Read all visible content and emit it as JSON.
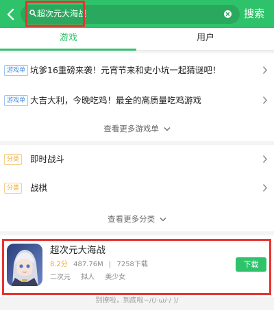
{
  "search": {
    "query": "超次元大海战",
    "button_label": "搜索"
  },
  "tabs": [
    {
      "label": "游戏",
      "active": true
    },
    {
      "label": "用户",
      "active": false
    }
  ],
  "game_lists": {
    "items": [
      {
        "tag": "游戏单",
        "title": "坑爹16重磅来袭！元宵节来和史小坑一起猜谜吧！"
      },
      {
        "tag": "游戏单",
        "title": "大吉大利，今晚吃鸡！最全的高质量吃鸡游戏"
      }
    ],
    "more_label": "查看更多游戏单"
  },
  "categories": {
    "items": [
      {
        "tag": "分类",
        "title": "即时战斗"
      },
      {
        "tag": "分类",
        "title": "战棋"
      }
    ],
    "more_label": "查看更多分类"
  },
  "app": {
    "name": "超次元大海战",
    "score": "8.2分",
    "size": "487.76M",
    "separator": "|",
    "downloads": "7258下载",
    "tags": [
      "二次元",
      "拟人",
      "美少女"
    ],
    "download_label": "下载"
  },
  "footer": "别撩啦，到底啦~/(/·ω/·/ )/",
  "colors": {
    "brand_green": "#2ec36a",
    "highlight_red": "#e8332f",
    "tag_blue": "#4a90e2",
    "tag_orange": "#f5a623"
  },
  "icons": [
    "back-arrow-icon",
    "search-icon",
    "clear-icon",
    "chevron-right-icon",
    "chevron-down-icon"
  ]
}
